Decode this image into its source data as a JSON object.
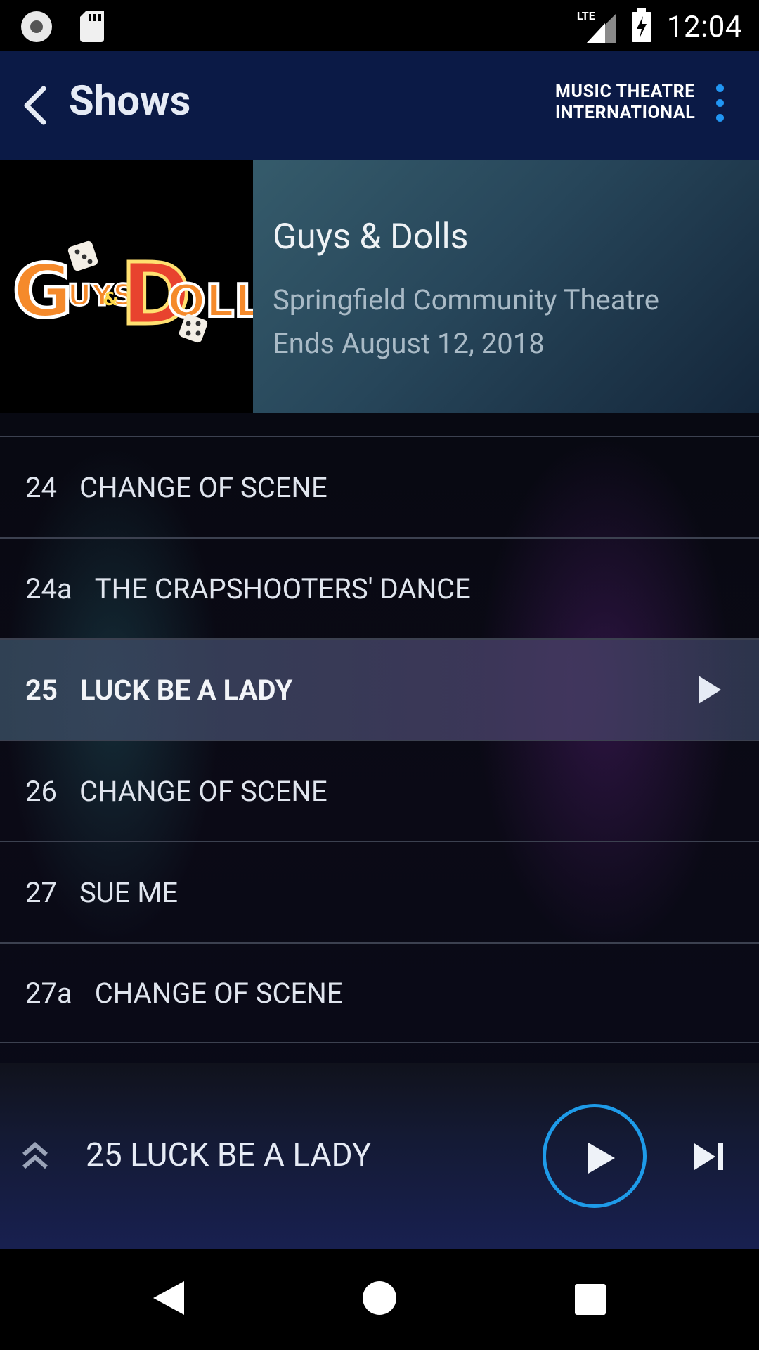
{
  "status_bar": {
    "network": "LTE",
    "time": "12:04"
  },
  "app_bar": {
    "title": "Shows",
    "brand_line1": "MUSIC THEATRE",
    "brand_line2": "INTERNATIONAL"
  },
  "show": {
    "logo_alt": "GUYS & DOLLS",
    "title": "Guys & Dolls",
    "venue": "Springfield Community Theatre",
    "ends": "Ends August 12, 2018"
  },
  "songs": [
    {
      "number": "24",
      "title": "CHANGE OF SCENE",
      "active": false
    },
    {
      "number": "24a",
      "title": "THE CRAPSHOOTERS' DANCE",
      "active": false
    },
    {
      "number": "25",
      "title": "LUCK BE A LADY",
      "active": true
    },
    {
      "number": "26",
      "title": "CHANGE OF SCENE",
      "active": false
    },
    {
      "number": "27",
      "title": "SUE ME",
      "active": false
    },
    {
      "number": "27a",
      "title": "CHANGE OF SCENE",
      "active": false
    }
  ],
  "player": {
    "now_playing": "25 LUCK BE A LADY"
  },
  "colors": {
    "app_bar_bg": "#0b1a46",
    "accent": "#1e9be9",
    "more_dots": "#2196f3"
  }
}
